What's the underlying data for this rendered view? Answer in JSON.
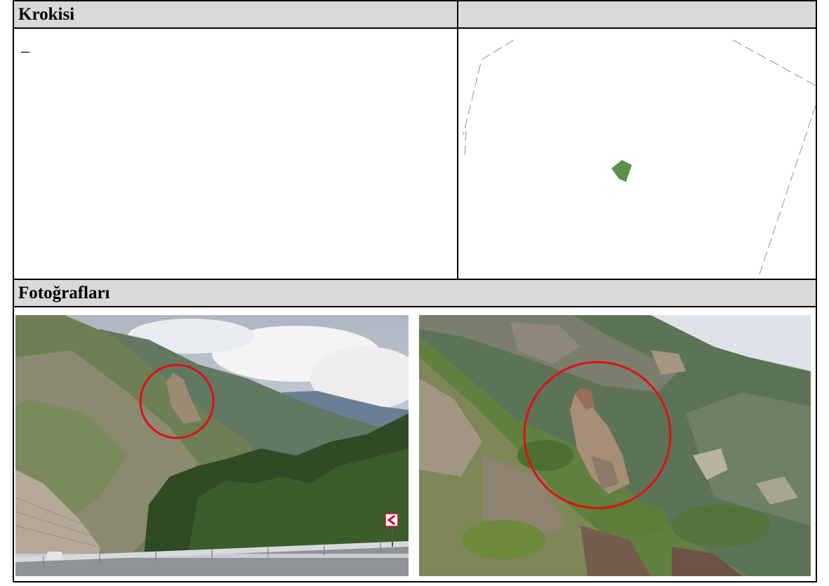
{
  "header_left": "Krokisi",
  "header_right": "",
  "krokisi_text": "–",
  "photos_header": "Fotoğrafları",
  "colors": {
    "header_bg": "#d9d9d9",
    "parcel": "#5b8f4a",
    "boundary": "#a8a8a8",
    "circle": "#e01010"
  },
  "icons": {
    "chevron_sign": "left-chevron-road-sign"
  }
}
